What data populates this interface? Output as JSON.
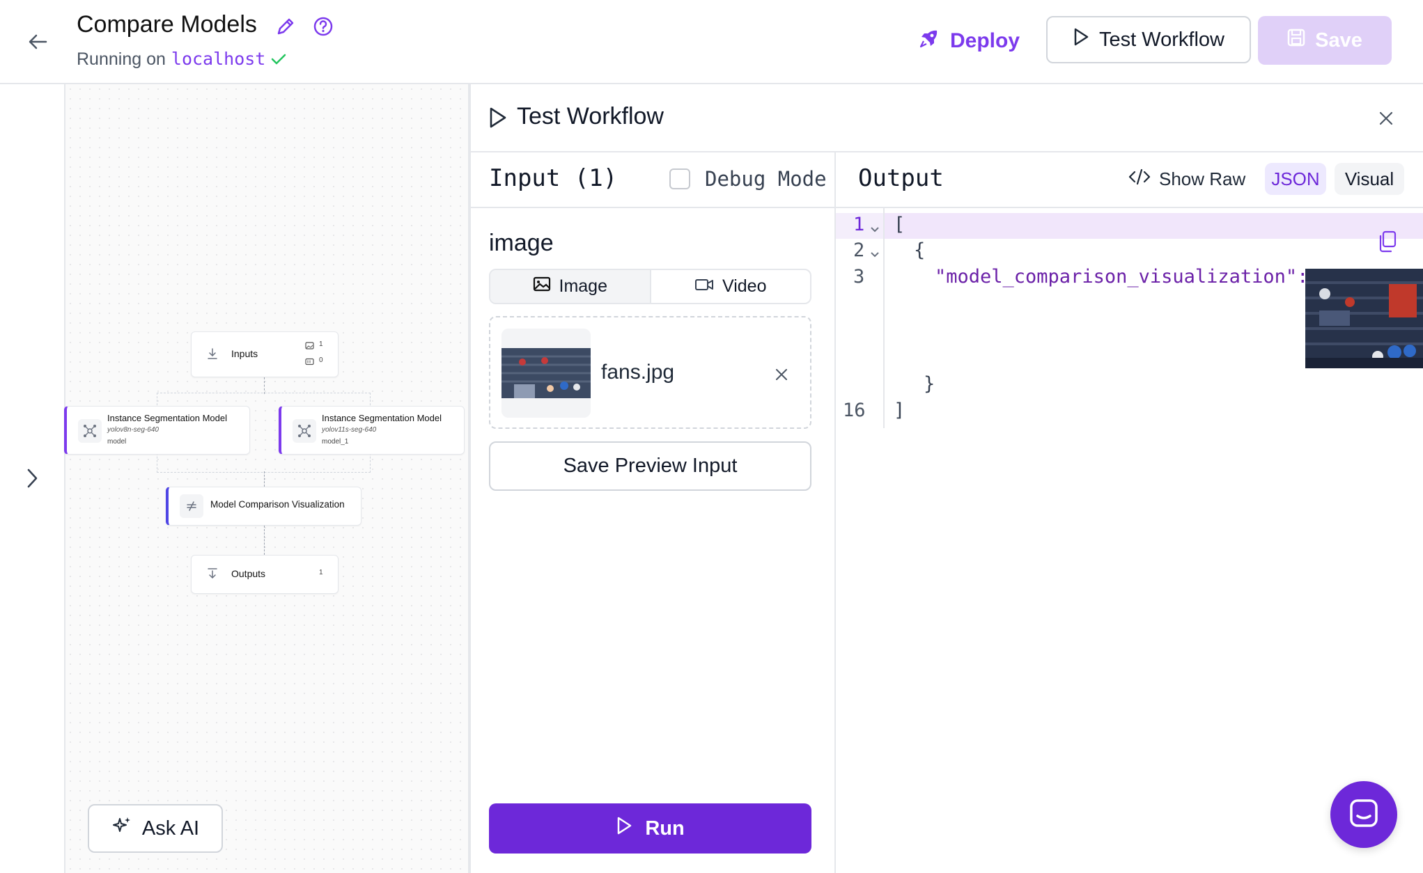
{
  "header": {
    "title": "Compare Models",
    "running_prefix": "Running on",
    "host": "localhost",
    "deploy_label": "Deploy",
    "test_workflow_label": "Test Workflow",
    "save_label": "Save"
  },
  "canvas": {
    "inputs_node": {
      "label": "Inputs",
      "image_count": "1",
      "video_count": "0"
    },
    "model_a": {
      "label": "Instance Segmentation Model",
      "model_id": "yolov8n-seg-640",
      "name": "model"
    },
    "model_b": {
      "label": "Instance Segmentation Model",
      "model_id": "yolov11s-seg-640",
      "name": "model_1"
    },
    "viz_node": {
      "label": "Model Comparison Visualization"
    },
    "outputs_node": {
      "label": "Outputs",
      "count": "1"
    },
    "ask_ai_label": "Ask AI"
  },
  "panel": {
    "title": "Test Workflow",
    "input": {
      "title": "Input (1)",
      "debug_label": "Debug Mode",
      "field_label": "image",
      "tabs": [
        {
          "label": "Image"
        },
        {
          "label": "Video"
        }
      ],
      "file_name": "fans.jpg",
      "save_preview_label": "Save Preview Input",
      "run_label": "Run"
    },
    "output": {
      "title": "Output",
      "show_raw_label": "Show Raw",
      "json_label": "JSON",
      "visual_label": "Visual",
      "lines": [
        {
          "num": "1",
          "text": "["
        },
        {
          "num": "2",
          "text": "{"
        },
        {
          "num": "3",
          "text": "\"model_comparison_visualization\":"
        },
        {
          "num": "",
          "text": "}"
        },
        {
          "num": "16",
          "text": "]"
        }
      ]
    }
  },
  "colors": {
    "accent": "#7c3aed",
    "run_button": "#6d28d9",
    "save_disabled": "#e0d0f8"
  }
}
